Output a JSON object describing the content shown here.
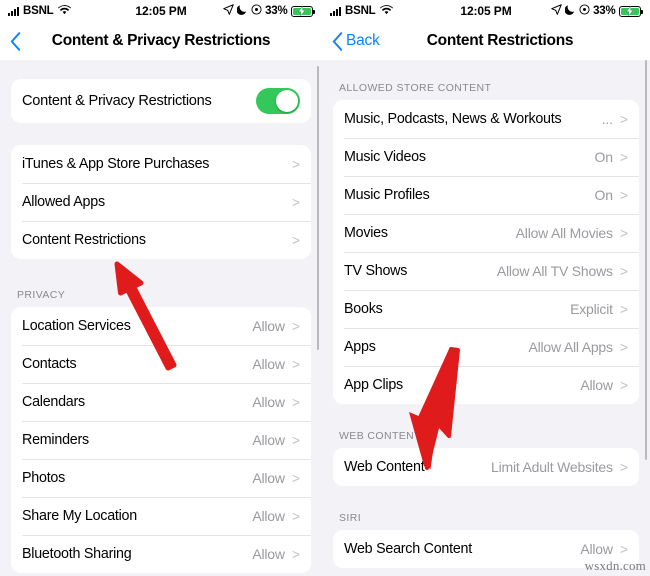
{
  "status_bar": {
    "carrier": "BSNL",
    "time": "12:05 PM",
    "battery_percent": "33%",
    "icons": [
      "signal-bars-icon",
      "wifi-icon",
      "location-arrow-icon",
      "moon-icon",
      "focus-icon",
      "battery-charging-icon"
    ]
  },
  "colors": {
    "accent_blue": "#0a84ff",
    "toggle_green": "#34c759",
    "arrow_red": "#e01b1b",
    "page_background": "#f2f2f7",
    "group_background": "#ffffff",
    "value_gray": "#9a9a9f"
  },
  "left_screen": {
    "nav": {
      "back_label": "",
      "title": "Content & Privacy Restrictions"
    },
    "toggle_row": {
      "label": "Content & Privacy Restrictions",
      "state": "on"
    },
    "main_group": [
      {
        "label": "iTunes & App Store Purchases",
        "value": "",
        "chevron": ">"
      },
      {
        "label": "Allowed Apps",
        "value": "",
        "chevron": ">"
      },
      {
        "label": "Content Restrictions",
        "value": "",
        "chevron": ">"
      }
    ],
    "privacy_header": "PRIVACY",
    "privacy_group": [
      {
        "label": "Location Services",
        "value": "Allow",
        "chevron": ">"
      },
      {
        "label": "Contacts",
        "value": "Allow",
        "chevron": ">"
      },
      {
        "label": "Calendars",
        "value": "Allow",
        "chevron": ">"
      },
      {
        "label": "Reminders",
        "value": "Allow",
        "chevron": ">"
      },
      {
        "label": "Photos",
        "value": "Allow",
        "chevron": ">"
      },
      {
        "label": "Share My Location",
        "value": "Allow",
        "chevron": ">"
      },
      {
        "label": "Bluetooth Sharing",
        "value": "Allow",
        "chevron": ">"
      }
    ]
  },
  "right_screen": {
    "nav": {
      "back_label": "Back",
      "title": "Content Restrictions"
    },
    "store_header": "ALLOWED STORE CONTENT",
    "store_group": [
      {
        "label": "Music, Podcasts, News & Workouts",
        "value": "...",
        "chevron": ">"
      },
      {
        "label": "Music Videos",
        "value": "On",
        "chevron": ">"
      },
      {
        "label": "Music Profiles",
        "value": "On",
        "chevron": ">"
      },
      {
        "label": "Movies",
        "value": "Allow All Movies",
        "chevron": ">"
      },
      {
        "label": "TV Shows",
        "value": "Allow All TV Shows",
        "chevron": ">"
      },
      {
        "label": "Books",
        "value": "Explicit",
        "chevron": ">"
      },
      {
        "label": "Apps",
        "value": "Allow All Apps",
        "chevron": ">"
      },
      {
        "label": "App Clips",
        "value": "Allow",
        "chevron": ">"
      }
    ],
    "web_header": "WEB CONTENT",
    "web_group": [
      {
        "label": "Web Content",
        "value": "Limit Adult Websites",
        "chevron": ">"
      }
    ],
    "siri_header": "SIRI",
    "siri_group": [
      {
        "label": "Web Search Content",
        "value": "Allow",
        "chevron": ">"
      }
    ]
  },
  "annotations": {
    "left_arrow": "red-arrow-pointing-to-content-restrictions",
    "right_arrow": "red-arrow-pointing-to-web-content"
  },
  "watermark": {
    "text": "wsxdn.com"
  }
}
